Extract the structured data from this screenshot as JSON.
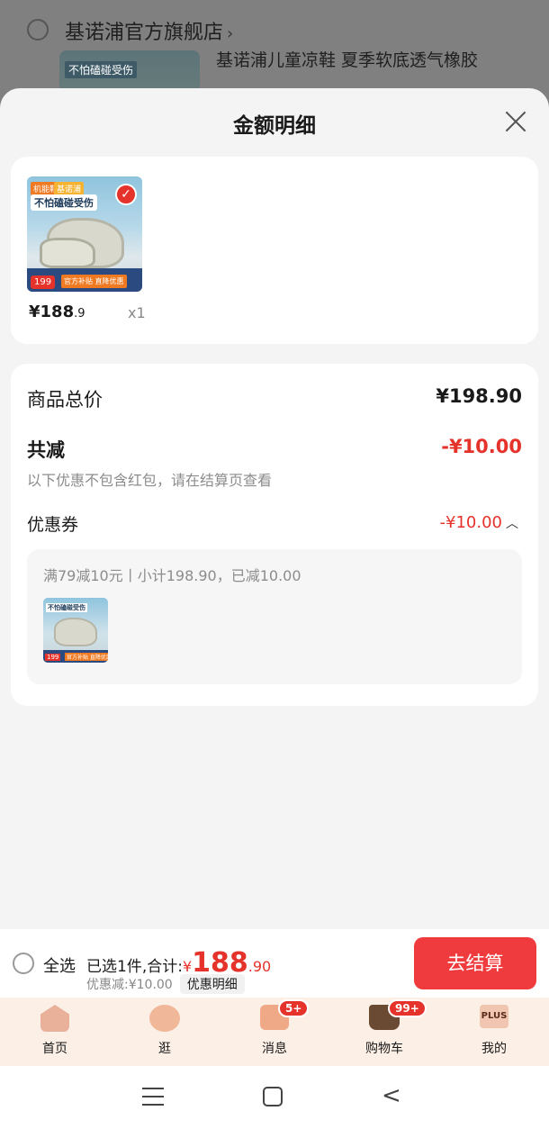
{
  "background_cart": {
    "store_name": "基诺浦官方旗舰店",
    "store_chevron": "›",
    "product_title": "基诺浦儿童凉鞋 夏季软底透气橡胶",
    "thumb_text": "不怕磕碰受伤"
  },
  "sheet": {
    "title": "金额明细",
    "close_icon": "close-icon"
  },
  "product": {
    "badges": [
      "机能鞋",
      "基诺浦"
    ],
    "slogan": "不怕磕碰受伤",
    "tag_price": "199",
    "promo": "官方补贴 直降优惠",
    "price_int": "¥188",
    "price_dec": ".9",
    "qty": "x1"
  },
  "summary": {
    "total_label": "商品总价",
    "total_value": "¥198.90",
    "reduce_label": "共减",
    "reduce_value": "-¥10.00",
    "note": "以下优惠不包含红包，请在结算页查看",
    "coupon_label": "优惠券",
    "coupon_value": "-¥10.00",
    "coupon_caret": "︿",
    "coupon_detail": "满79减10元丨小计198.90，已减10.00"
  },
  "checkout": {
    "select_all": "全选",
    "selected_text": "已选1件,合计:",
    "currency": "¥",
    "amount_int": "188",
    "amount_dec": ".90",
    "discount_text": "优惠减:¥10.00",
    "detail_button": "优惠明细",
    "pay_button": "去结算"
  },
  "tabbar": {
    "items": [
      {
        "label": "首页",
        "icon": "home-icon"
      },
      {
        "label": "逛",
        "icon": "face-icon"
      },
      {
        "label": "消息",
        "icon": "message-icon",
        "badge": "5+"
      },
      {
        "label": "购物车",
        "icon": "cart-icon",
        "badge": "99+"
      },
      {
        "label": "我的",
        "icon": "plus-icon",
        "icon_text": "PLUS"
      }
    ]
  },
  "colors": {
    "accent_red": "#e5322a",
    "pay_button": "#ef3b3e"
  }
}
